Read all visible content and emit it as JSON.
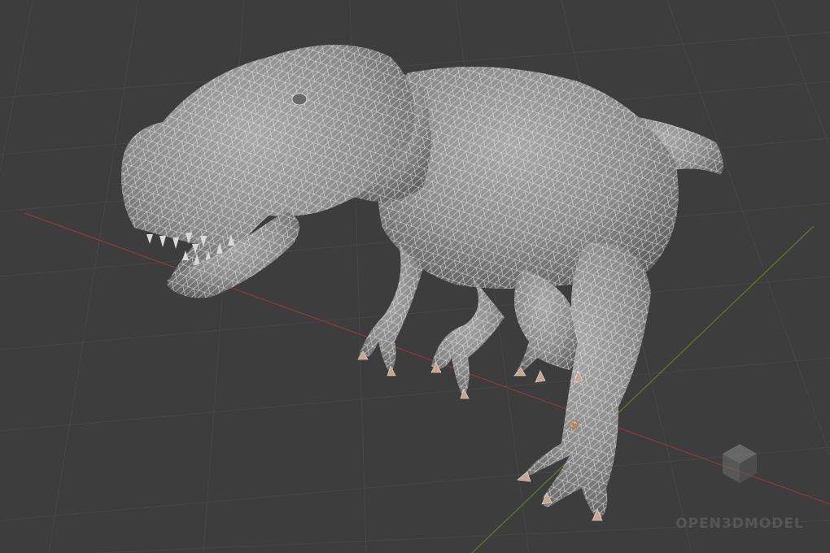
{
  "viewport": {
    "background": "#3d3d3d",
    "grid_color": "#474747",
    "x_axis_color": "#8a3a3e",
    "y_axis_color": "#5e7a2c",
    "model_fill": "#8c8c8c",
    "wire_color": "#e8e8e8",
    "claw_color": "#c9a58f",
    "origin_marker": "3d-cursor"
  },
  "watermark": {
    "text": "OPEN3DMODEL",
    "icon": "cube-logo-icon"
  }
}
